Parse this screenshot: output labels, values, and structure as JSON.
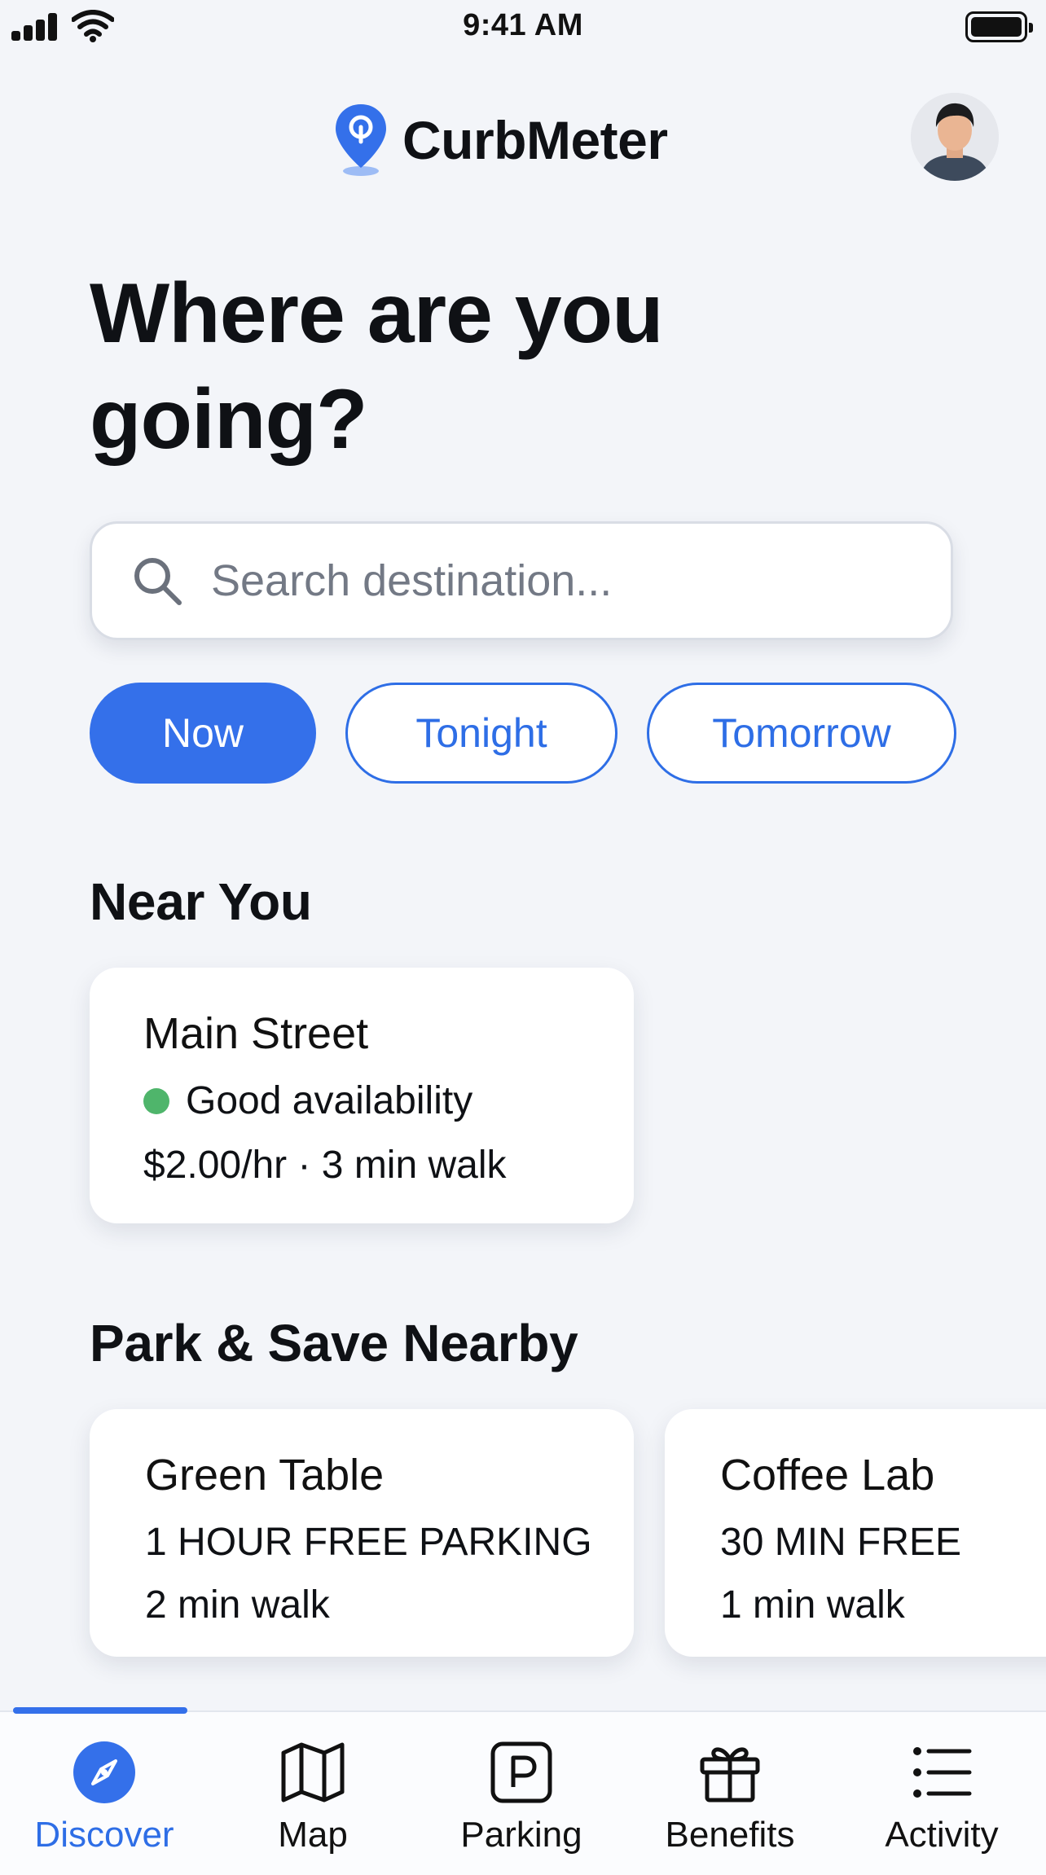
{
  "status_bar": {
    "time": "9:41 AM"
  },
  "header": {
    "app_name": "CurbMeter",
    "avatar_label": "Profile"
  },
  "hero": {
    "line1": "Where are you",
    "line2": "going?"
  },
  "search": {
    "placeholder": "Search destination..."
  },
  "time_filters": [
    {
      "label": "Now",
      "selected": true
    },
    {
      "label": "Tonight",
      "selected": false
    },
    {
      "label": "Tomorrow",
      "selected": false
    }
  ],
  "near_you": {
    "title": "Near You",
    "card": {
      "name": "Main Street",
      "availability": "Good availability",
      "availability_color": "#4fb56b",
      "meta": "$2.00/hr · 3 min walk"
    }
  },
  "park_save": {
    "title": "Park & Save Nearby",
    "deals": [
      {
        "name": "Green Table",
        "offer": "1 HOUR FREE PARKING",
        "walk": "2 min walk"
      },
      {
        "name": "Coffee Lab",
        "offer": "30 MIN FREE",
        "walk": "1 min walk"
      }
    ]
  },
  "tabs": [
    {
      "label": "Discover",
      "icon": "compass-icon",
      "active": true
    },
    {
      "label": "Map",
      "icon": "map-icon",
      "active": false
    },
    {
      "label": "Parking",
      "icon": "parking-icon",
      "active": false
    },
    {
      "label": "Benefits",
      "icon": "gift-icon",
      "active": false
    },
    {
      "label": "Activity",
      "icon": "list-icon",
      "active": false
    }
  ],
  "colors": {
    "accent": "#3470ea",
    "background": "#f3f5f9",
    "available": "#4fb56b"
  }
}
